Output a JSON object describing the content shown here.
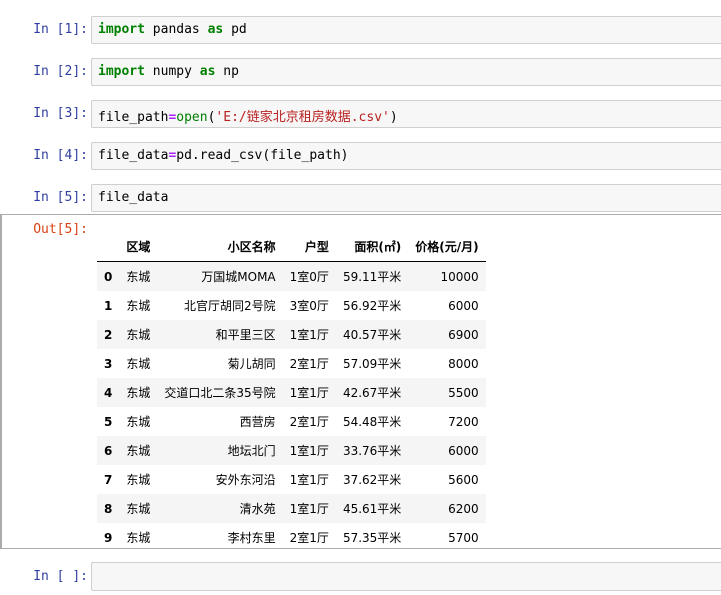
{
  "cells": [
    {
      "prompt": "In  [1]:",
      "code": [
        {
          "t": "import",
          "c": "kw"
        },
        {
          "t": " pandas ",
          "c": ""
        },
        {
          "t": "as",
          "c": "kw"
        },
        {
          "t": " pd",
          "c": ""
        }
      ]
    },
    {
      "prompt": "In  [2]:",
      "code": [
        {
          "t": "import",
          "c": "kw"
        },
        {
          "t": " numpy ",
          "c": ""
        },
        {
          "t": "as",
          "c": "kw"
        },
        {
          "t": " np",
          "c": ""
        }
      ]
    },
    {
      "prompt": "In  [3]:",
      "code": [
        {
          "t": "file_path",
          "c": ""
        },
        {
          "t": "=",
          "c": "op"
        },
        {
          "t": "open",
          "c": "bi"
        },
        {
          "t": "(",
          "c": ""
        },
        {
          "t": "'E:/链家北京租房数据.csv'",
          "c": "str"
        },
        {
          "t": ")",
          "c": ""
        }
      ]
    },
    {
      "prompt": "In  [4]:",
      "code": [
        {
          "t": "file_data",
          "c": ""
        },
        {
          "t": "=",
          "c": "op"
        },
        {
          "t": "pd.read_csv(file_path)",
          "c": ""
        }
      ]
    },
    {
      "prompt": "In  [5]:",
      "code": [
        {
          "t": "file_data",
          "c": ""
        }
      ]
    }
  ],
  "output": {
    "prompt": "Out[5]:",
    "columns": [
      "",
      "区域",
      "小区名称",
      "户型",
      "面积(㎡)",
      "价格(元/月)"
    ],
    "rows": [
      [
        "0",
        "东城",
        "万国城MOMA",
        "1室0厅",
        "59.11平米",
        "10000"
      ],
      [
        "1",
        "东城",
        "北官厅胡同2号院",
        "3室0厅",
        "56.92平米",
        "6000"
      ],
      [
        "2",
        "东城",
        "和平里三区",
        "1室1厅",
        "40.57平米",
        "6900"
      ],
      [
        "3",
        "东城",
        "菊儿胡同",
        "2室1厅",
        "57.09平米",
        "8000"
      ],
      [
        "4",
        "东城",
        "交道口北二条35号院",
        "1室1厅",
        "42.67平米",
        "5500"
      ],
      [
        "5",
        "东城",
        "西营房",
        "2室1厅",
        "54.48平米",
        "7200"
      ],
      [
        "6",
        "东城",
        "地坛北门",
        "1室1厅",
        "33.76平米",
        "6000"
      ],
      [
        "7",
        "东城",
        "安外东河沿",
        "1室1厅",
        "37.62平米",
        "5600"
      ],
      [
        "8",
        "东城",
        "清水苑",
        "1室1厅",
        "45.61平米",
        "6200"
      ],
      [
        "9",
        "东城",
        "李村东里",
        "2室1厅",
        "57.35平米",
        "5700"
      ]
    ]
  },
  "empty_cell": {
    "prompt": "In  [ ]:",
    "code": ""
  }
}
